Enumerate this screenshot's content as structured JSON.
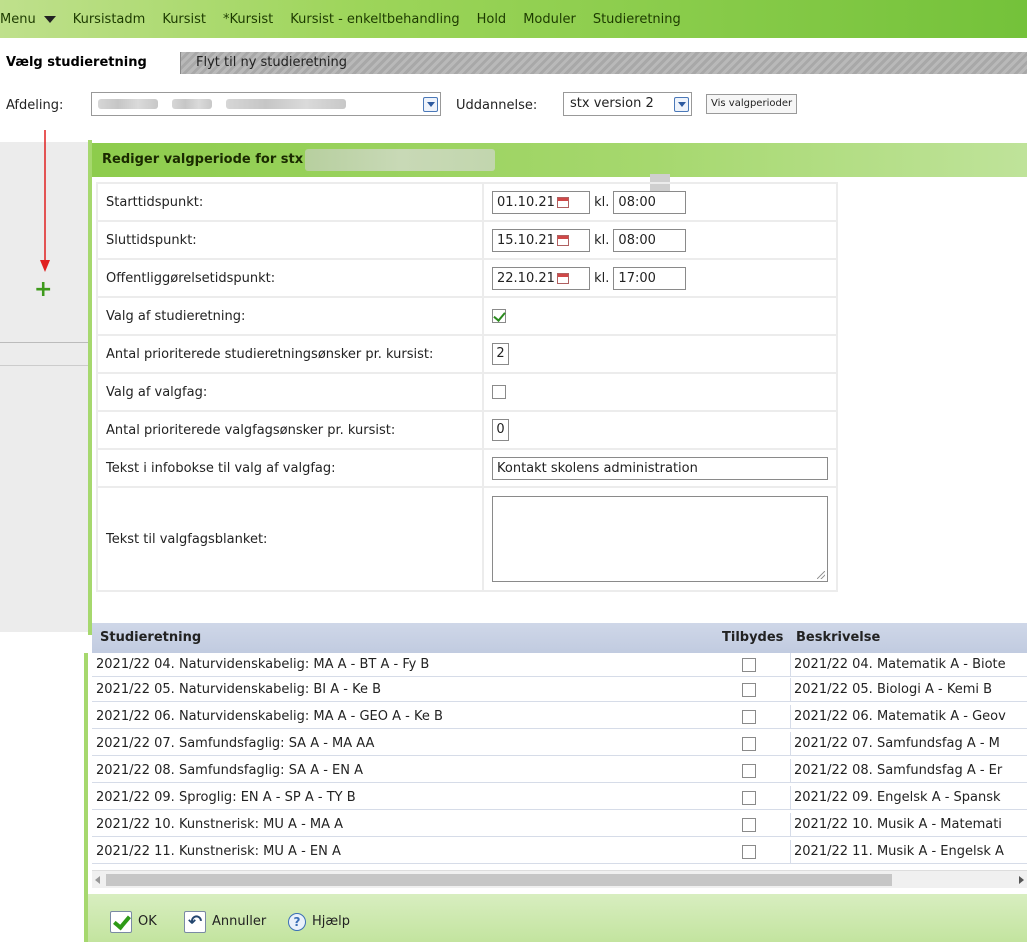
{
  "menubar": {
    "menu_label": "Menu",
    "items": [
      "Kursistadm",
      "Kursist",
      "*Kursist",
      "Kursist - enkeltbehandling",
      "Hold",
      "Moduler",
      "Studieretning"
    ]
  },
  "tabs": {
    "active": "Vælg studieretning",
    "inactive": "Flyt til ny studieretning"
  },
  "filters": {
    "afdeling_label": "Afdeling:",
    "uddannelse_label": "Uddannelse:",
    "uddannelse_value": "stx version 2",
    "vis_button": "Vis valgperioder"
  },
  "dialog": {
    "title": "Rediger valgperiode for stx",
    "fields": {
      "start_label": "Starttidspunkt:",
      "start_date": "01.10.21",
      "start_time": "08:00",
      "slut_label": "Sluttidspunkt:",
      "slut_date": "15.10.21",
      "slut_time": "08:00",
      "offentlig_label": "Offentliggørelsetidspunkt:",
      "offentlig_date": "22.10.21",
      "offentlig_time": "17:00",
      "kl_label": "kl.",
      "valg_studieretning_label": "Valg af studieretning:",
      "antal_studieretning_label": "Antal prioriterede studieretningsønsker pr. kursist:",
      "antal_studieretning_value": "2",
      "valg_valgfag_label": "Valg af valgfag:",
      "antal_valgfag_label": "Antal prioriterede valgfagsønsker pr. kursist:",
      "antal_valgfag_value": "0",
      "infobokse_label": "Tekst i infobokse til valg af valgfag:",
      "infobokse_value": "Kontakt skolens administration",
      "valgfagsblanket_label": "Tekst til valgfagsblanket:"
    }
  },
  "list": {
    "headers": {
      "studieretning": "Studieretning",
      "tilbydes": "Tilbydes",
      "beskrivelse": "Beskrivelse"
    },
    "rows": [
      {
        "name": "2021/22 04. Naturvidenskabelig: MA A - BT A - Fy B",
        "desc": "2021/22 04. Matematik A - Biote"
      },
      {
        "name": "2021/22 05. Naturvidenskabelig: BI A - Ke B",
        "desc": "2021/22 05. Biologi A - Kemi B"
      },
      {
        "name": "2021/22 06. Naturvidenskabelig: MA A - GEO A - Ke B",
        "desc": "2021/22 06. Matematik A - Geov"
      },
      {
        "name": "2021/22 07. Samfundsfaglig: SA A - MA AA",
        "desc": "2021/22 07. Samfundsfag A - M"
      },
      {
        "name": "2021/22 08. Samfundsfaglig: SA A - EN A",
        "desc": "2021/22 08. Samfundsfag A - Er"
      },
      {
        "name": "2021/22 09. Sproglig: EN A - SP A - TY B",
        "desc": "2021/22 09. Engelsk A - Spansk"
      },
      {
        "name": "2021/22 10. Kunstnerisk: MU A - MA A",
        "desc": "2021/22 10. Musik A - Matemati"
      },
      {
        "name": "2021/22 11. Kunstnerisk: MU A - EN A",
        "desc": "2021/22 11. Musik A - Engelsk A"
      }
    ]
  },
  "footer": {
    "ok": "OK",
    "annuller": "Annuller",
    "hjaelp": "Hjælp"
  },
  "colors": {
    "accent_green": "#8dcc4c",
    "list_header": "#c1cbe0",
    "annotation_arrow": "#e02020"
  }
}
